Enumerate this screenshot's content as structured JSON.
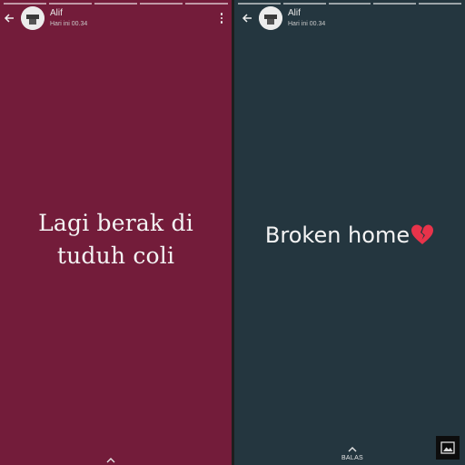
{
  "left_story": {
    "author_name": "Alif",
    "timestamp": "Hari ini 00.34",
    "caption_line1": "Lagi berak di",
    "caption_line2": "tuduh coli",
    "background_color": "#731c3a",
    "icons": [
      "back-arrow-icon",
      "avatar",
      "more-vert-icon",
      "chevron-up-icon"
    ]
  },
  "right_story": {
    "author_name": "Alif",
    "timestamp": "Hari ini 00.34",
    "caption": "Broken home",
    "caption_emoji_icon": "broken-heart-icon",
    "reply_label": "BALAS",
    "background_color": "#24363f",
    "icons": [
      "back-arrow-icon",
      "avatar",
      "chevron-up-icon",
      "gallery-icon"
    ]
  }
}
